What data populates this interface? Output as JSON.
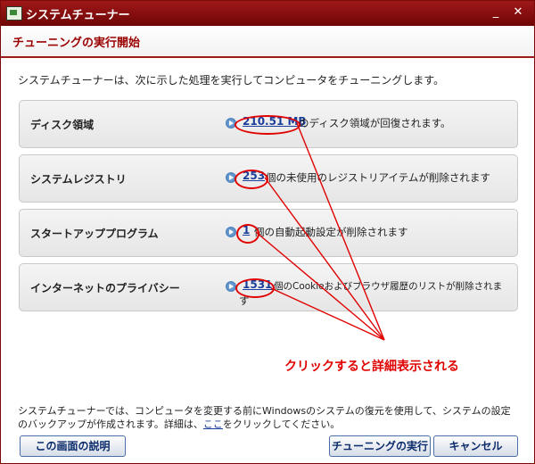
{
  "window": {
    "title": "システムチューナー",
    "minimize": "_",
    "close": "✕"
  },
  "header": {
    "title": "チューニングの実行開始"
  },
  "intro": "システムチューナーは、次に示した処理を実行してコンピュータをチューニングします。",
  "items": [
    {
      "label": "ディスク領域",
      "value": "210.51 MB",
      "description": "のディスク領域が回復されます。"
    },
    {
      "label": "システムレジストリ",
      "value": "253",
      "description": "個の未使用のレジストリアイテムが削除されます"
    },
    {
      "label": "スタートアッププログラム",
      "value": "1",
      "description": "個の自動起動設定が削除されます"
    },
    {
      "label": "インターネットのプライバシー",
      "value": "1531",
      "description": "個のCookieおよびブラウザ履歴のリストが削除されま",
      "description_cont": "す"
    }
  ],
  "annotation": "クリックすると詳細表示される",
  "footer": {
    "note_line1": "システムチューナーでは、コンピュータを変更する前にWindowsのシステムの復元を使用して、システムの設定",
    "note_line2_pre": "のバックアップが作成されます。詳細は、",
    "note_link": "ここ",
    "note_line2_post": "をクリックしてください。"
  },
  "buttons": {
    "help": "この画面の説明",
    "run": "チューニングの実行",
    "cancel": "キャンセル"
  },
  "colors": {
    "title_bar": "#8a0c0c",
    "header_text": "#9a0000",
    "annotation": "#e00000",
    "link": "#1a3e9a"
  }
}
